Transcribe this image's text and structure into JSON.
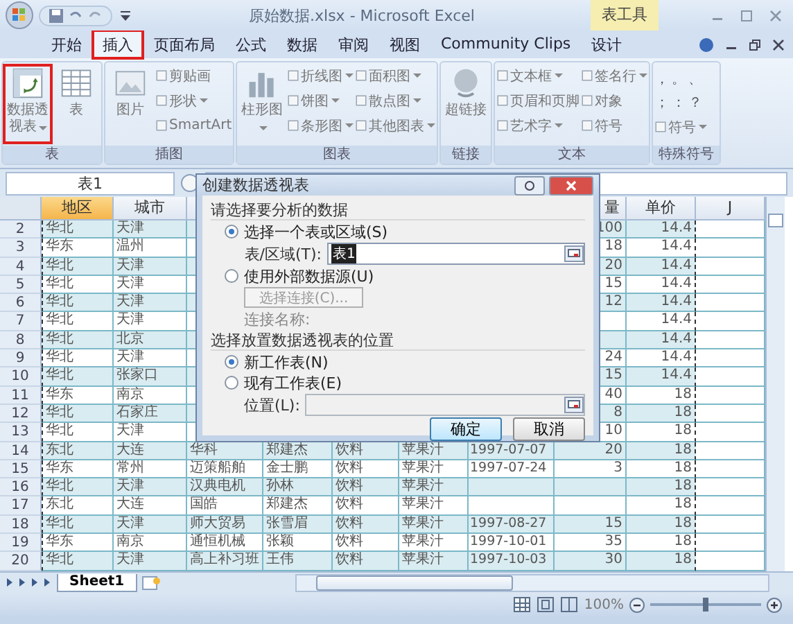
{
  "window": {
    "title": "原始数据.xlsx - Microsoft Excel",
    "context_tab": "表工具"
  },
  "ribbon_tabs": [
    {
      "label": "开始",
      "selected": false,
      "highlighted": false
    },
    {
      "label": "插入",
      "selected": true,
      "highlighted": true
    },
    {
      "label": "页面布局",
      "selected": false,
      "highlighted": false
    },
    {
      "label": "公式",
      "selected": false,
      "highlighted": false
    },
    {
      "label": "数据",
      "selected": false,
      "highlighted": false
    },
    {
      "label": "审阅",
      "selected": false,
      "highlighted": false
    },
    {
      "label": "视图",
      "selected": false,
      "highlighted": false
    },
    {
      "label": "Community Clips",
      "selected": false,
      "highlighted": false
    },
    {
      "label": "设计",
      "selected": false,
      "highlighted": false
    }
  ],
  "ribbon_groups": [
    {
      "label": "表",
      "items": [
        {
          "kind": "large",
          "label": "数据透视表",
          "dropdown": true,
          "highlighted": true
        },
        {
          "kind": "large",
          "label": "表",
          "dropdown": false,
          "highlighted": false
        }
      ]
    },
    {
      "label": "插图",
      "items": [
        {
          "kind": "large",
          "label": "图片",
          "dropdown": false,
          "highlighted": false
        },
        {
          "kind": "small",
          "label": "剪贴画",
          "dropdown": false
        },
        {
          "kind": "small",
          "label": "形状",
          "dropdown": true
        },
        {
          "kind": "small",
          "label": "SmartArt",
          "dropdown": false
        }
      ]
    },
    {
      "label": "图表",
      "items": [
        {
          "kind": "large",
          "label": "柱形图",
          "dropdown": true,
          "highlighted": false
        },
        {
          "kind": "small",
          "label": "折线图",
          "dropdown": true
        },
        {
          "kind": "small",
          "label": "饼图",
          "dropdown": true
        },
        {
          "kind": "small",
          "label": "条形图",
          "dropdown": true
        },
        {
          "kind": "small",
          "label": "面积图",
          "dropdown": true
        },
        {
          "kind": "small",
          "label": "散点图",
          "dropdown": true
        },
        {
          "kind": "small",
          "label": "其他图表",
          "dropdown": true
        }
      ]
    },
    {
      "label": "链接",
      "items": [
        {
          "kind": "large",
          "label": "超链接",
          "dropdown": false,
          "highlighted": false
        }
      ]
    },
    {
      "label": "文本",
      "items": [
        {
          "kind": "small",
          "label": "文本框",
          "dropdown": true
        },
        {
          "kind": "small",
          "label": "页眉和页脚",
          "dropdown": false
        },
        {
          "kind": "small",
          "label": "艺术字",
          "dropdown": true
        },
        {
          "kind": "small",
          "label": "签名行",
          "dropdown": true
        },
        {
          "kind": "small",
          "label": "对象",
          "dropdown": false
        },
        {
          "kind": "small",
          "label": "符号",
          "dropdown": false
        }
      ]
    },
    {
      "label": "特殊符号",
      "items": [
        {
          "kind": "symbol",
          "label": "，"
        },
        {
          "kind": "symbol",
          "label": "。"
        },
        {
          "kind": "symbol",
          "label": "、"
        },
        {
          "kind": "symbol",
          "label": "；"
        },
        {
          "kind": "symbol",
          "label": "："
        },
        {
          "kind": "symbol",
          "label": "？"
        },
        {
          "kind": "small",
          "label": "符号",
          "dropdown": true
        }
      ]
    }
  ],
  "name_box": "表1",
  "columns": [
    {
      "label": "地区",
      "selected": true
    },
    {
      "label": "城市",
      "selected": false
    },
    null,
    null,
    null,
    null,
    null,
    {
      "label": "量",
      "selected": false
    },
    {
      "label": "单价",
      "selected": false
    },
    {
      "label": "J",
      "selected": false
    }
  ],
  "rows": [
    {
      "number": "2",
      "cells": [
        "华北",
        "天津",
        null,
        null,
        null,
        null,
        null,
        "100",
        "14.4"
      ]
    },
    {
      "number": "3",
      "cells": [
        "华东",
        "温州",
        null,
        null,
        null,
        null,
        null,
        "18",
        "14.4"
      ]
    },
    {
      "number": "4",
      "cells": [
        "华北",
        "天津",
        null,
        null,
        null,
        null,
        null,
        "20",
        "14.4"
      ]
    },
    {
      "number": "5",
      "cells": [
        "华北",
        "天津",
        null,
        null,
        null,
        null,
        null,
        "15",
        "14.4"
      ]
    },
    {
      "number": "6",
      "cells": [
        "华北",
        "天津",
        null,
        null,
        null,
        null,
        null,
        "12",
        "14.4"
      ]
    },
    {
      "number": "7",
      "cells": [
        "华北",
        "天津",
        null,
        null,
        null,
        null,
        null,
        null,
        "14.4"
      ]
    },
    {
      "number": "8",
      "cells": [
        "华北",
        "北京",
        null,
        null,
        null,
        null,
        null,
        null,
        "14.4"
      ]
    },
    {
      "number": "9",
      "cells": [
        "华北",
        "天津",
        null,
        null,
        null,
        null,
        null,
        "24",
        "14.4"
      ]
    },
    {
      "number": "10",
      "cells": [
        "华北",
        "张家口",
        null,
        null,
        null,
        null,
        null,
        "15",
        "14.4"
      ]
    },
    {
      "number": "11",
      "cells": [
        "华东",
        "南京",
        null,
        null,
        null,
        null,
        null,
        "40",
        "18"
      ]
    },
    {
      "number": "12",
      "cells": [
        "华北",
        "石家庄",
        null,
        null,
        null,
        null,
        null,
        "8",
        "18"
      ]
    },
    {
      "number": "13",
      "cells": [
        "华北",
        "天津",
        null,
        null,
        null,
        null,
        null,
        "10",
        "18"
      ]
    },
    {
      "number": "14",
      "cells": [
        "东北",
        "大连",
        "华科",
        "郑建杰",
        "饮料",
        "苹果汁",
        "1997-07-07",
        "20",
        "18"
      ]
    },
    {
      "number": "15",
      "cells": [
        "华东",
        "常州",
        "迈策船舶",
        "金士鹏",
        "饮料",
        "苹果汁",
        "1997-07-24",
        "3",
        "18"
      ]
    },
    {
      "number": "16",
      "cells": [
        "华北",
        "天津",
        "汉典电机",
        "孙林",
        "饮料",
        "苹果汁",
        null,
        null,
        "18"
      ]
    },
    {
      "number": "17",
      "cells": [
        "东北",
        "大连",
        "国皓",
        "郑建杰",
        "饮料",
        "苹果汁",
        null,
        null,
        "18"
      ]
    },
    {
      "number": "18",
      "cells": [
        "华北",
        "天津",
        "师大贸易",
        "张雪眉",
        "饮料",
        "苹果汁",
        "1997-08-27",
        "15",
        "18"
      ]
    },
    {
      "number": "19",
      "cells": [
        "华东",
        "南京",
        "通恒机械",
        "张颖",
        "饮料",
        "苹果汁",
        "1997-10-01",
        "35",
        "18"
      ]
    },
    {
      "number": "20",
      "cells": [
        "华北",
        "天津",
        "高上补习班",
        "王伟",
        "饮料",
        "苹果汁",
        "1997-10-03",
        "30",
        "18"
      ]
    }
  ],
  "dialog": {
    "title": "创建数据透视表",
    "section_1": "请选择要分析的数据",
    "source_options": [
      {
        "label": "选择一个表或区域(S)",
        "selected": true
      },
      {
        "label": "使用外部数据源(U)",
        "selected": false
      }
    ],
    "range_label": "表/区域(T):",
    "range_value": "表1",
    "connection_button": {
      "label": "选择连接(C)...",
      "disabled": true
    },
    "connection_label": {
      "text": "连接名称:",
      "disabled": true
    },
    "section_2": "选择放置数据透视表的位置",
    "location_options": [
      {
        "label": "新工作表(N)",
        "selected": true
      },
      {
        "label": "现有工作表(E)",
        "selected": false
      }
    ],
    "location_field": {
      "label": "位置(L):",
      "disabled": true
    },
    "buttons": [
      {
        "label": "确定",
        "default": true
      },
      {
        "label": "取消",
        "default": false
      }
    ]
  },
  "sheet_tabs": [
    {
      "label": "Sheet1",
      "selected": true
    }
  ],
  "zoom": {
    "label": "100%",
    "level": 0.5
  }
}
